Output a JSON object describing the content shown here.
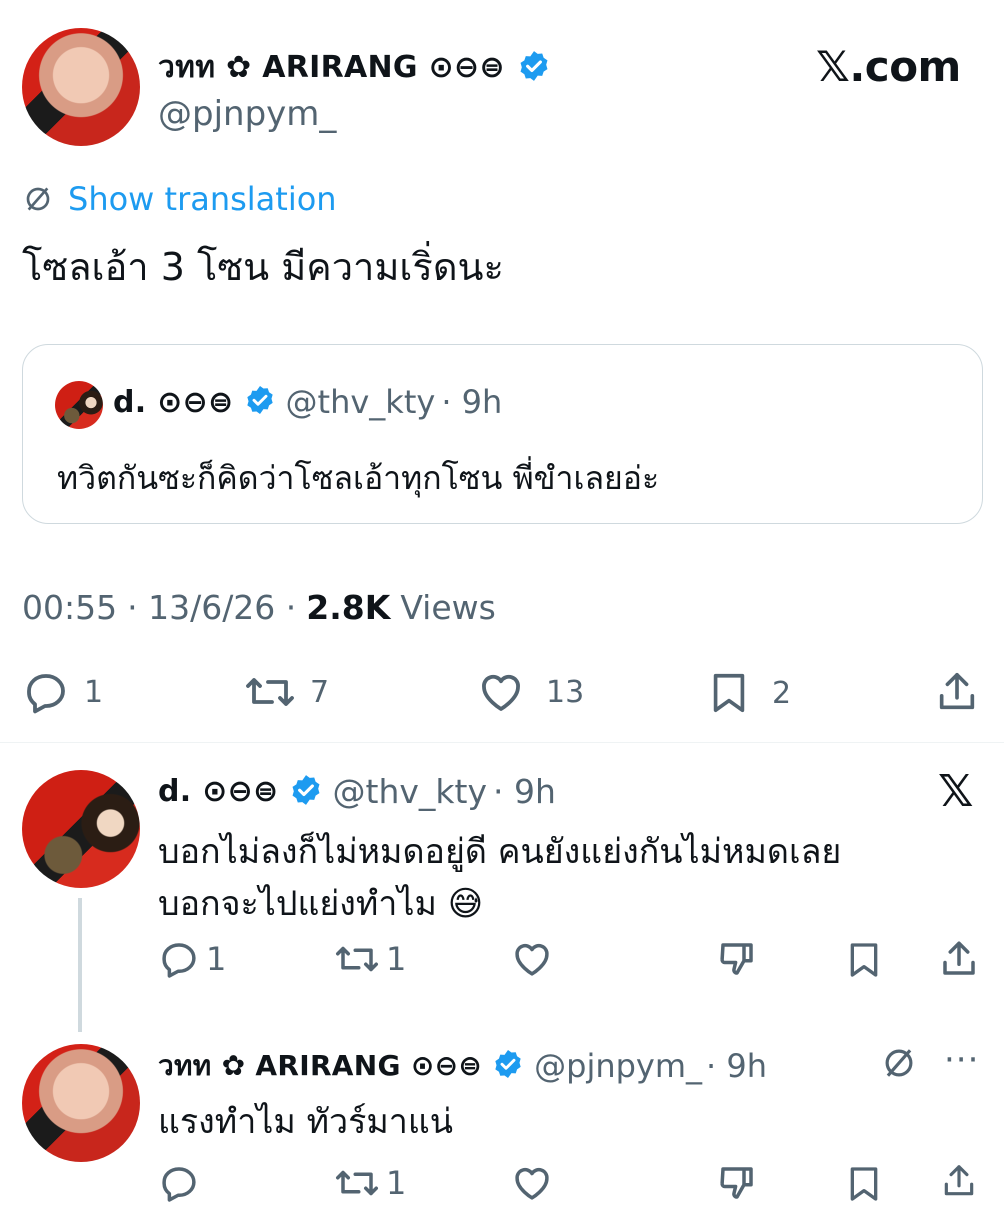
{
  "brand": {
    "site": "𝕏.com"
  },
  "tweet": {
    "author": {
      "name": "วทท ✿ ARIRANG ⊙⊖⊜",
      "handle": "@pjnpym_"
    },
    "show_translation": "Show translation",
    "text": "โซลเอ้า 3 โซน มีความเริ่ดนะ",
    "quote": {
      "author": {
        "name": "d. ⊙⊖⊜",
        "handle": "@thv_kty",
        "time": "· 9h"
      },
      "text": "ทวิตกันซะก็คิดว่าโซลเอ้าทุกโซน พี่ขำเลยอ่ะ"
    },
    "meta": {
      "time": "00:55",
      "date": "· 13/6/26 ·",
      "views_count": "2.8K",
      "views_label": "Views"
    },
    "actions": {
      "replies": "1",
      "reposts": "7",
      "likes": "13",
      "bookmarks": "2"
    }
  },
  "replies": [
    {
      "author": {
        "name": "d. ⊙⊖⊜",
        "handle": "@thv_kty",
        "time": "· 9h"
      },
      "text_line1": "บอกไม่ลงก็ไม่หมดอยู่ดี คนยังแย่งกันไม่หมดเลย",
      "text_line2": "บอกจะไปแย่งทำไม 😅",
      "actions": {
        "replies": "1",
        "reposts": "1"
      }
    },
    {
      "author": {
        "name": "วทท ✿ ARIRANG ⊙⊖⊜",
        "handle": "@pjnpym_",
        "time": "· 9h"
      },
      "text": "แรงทำไม ทัวร์มาแน่",
      "actions": {
        "reposts": "1"
      }
    }
  ],
  "colors": {
    "accent": "#1d9bf0",
    "muted": "#536471",
    "border": "#cfd9de"
  }
}
